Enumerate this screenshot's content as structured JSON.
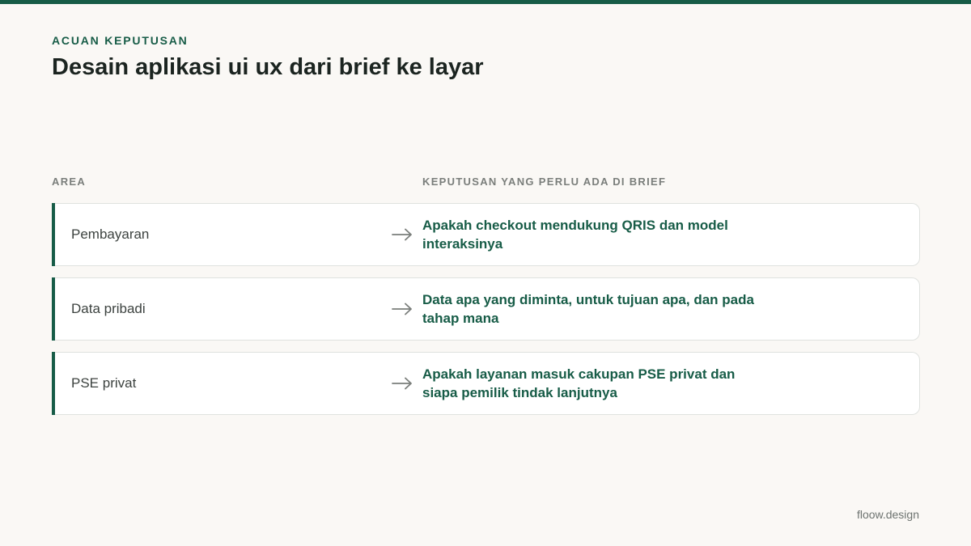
{
  "header": {
    "eyebrow": "ACUAN KEPUTUSAN",
    "title": "Desain aplikasi ui ux dari brief ke layar"
  },
  "table": {
    "headers": {
      "area": "AREA",
      "decision": "KEPUTUSAN YANG PERLU ADA DI BRIEF"
    },
    "rows": [
      {
        "area": "Pembayaran",
        "decision": "Apakah checkout mendukung QRIS dan model interaksinya"
      },
      {
        "area": "Data pribadi",
        "decision": "Data apa yang diminta, untuk tujuan apa, dan pada tahap mana"
      },
      {
        "area": "PSE privat",
        "decision": "Apakah layanan masuk cakupan PSE privat dan siapa pemilik tindak lanjutnya"
      }
    ]
  },
  "footer": {
    "brand": "floow.design"
  },
  "colors": {
    "accent": "#175c47",
    "background": "#faf8f5",
    "arrow": "#7a7e7b"
  },
  "icons": {
    "row_arrow": "arrow-right-icon"
  }
}
